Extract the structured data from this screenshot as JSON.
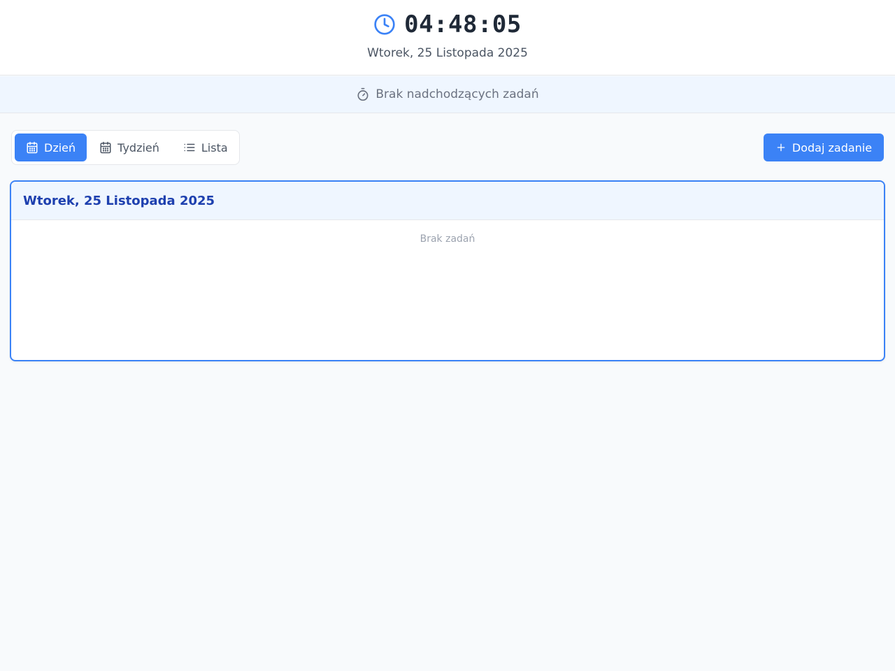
{
  "header": {
    "time": "04:48:05",
    "date": "Wtorek, 25 Listopada 2025",
    "icon": "clock-icon"
  },
  "banner": {
    "text": "Brak nadchodzących zadań",
    "icon": "timer-icon"
  },
  "view_switcher": {
    "active": "Dzień",
    "items": [
      {
        "label": "Dzień",
        "icon": "calendar-icon"
      },
      {
        "label": "Tydzień",
        "icon": "calendar-icon"
      },
      {
        "label": "Lista",
        "icon": "list-icon"
      }
    ]
  },
  "toolbar": {
    "add_label": "Dodaj zadanie",
    "add_icon": "plus-icon"
  },
  "day_card": {
    "title": "Wtorek, 25 Listopada 2025",
    "empty_text": "Brak zadań"
  },
  "colors": {
    "accent": "#3b82f6",
    "accent_light": "#eff6ff",
    "heading": "#1e40af",
    "background": "#f8fafc"
  }
}
